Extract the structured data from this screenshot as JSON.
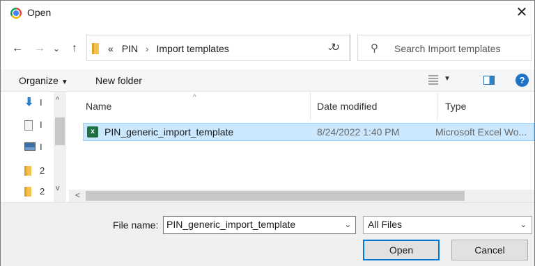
{
  "window": {
    "title": "Open",
    "close_glyph": "✕"
  },
  "nav": {
    "back_glyph": "←",
    "forward_glyph": "→",
    "recent_glyph": "⌄",
    "up_glyph": "↑",
    "breadcrumb": {
      "overflow": "«",
      "parts": [
        "PIN",
        "Import templates"
      ],
      "separator": "›"
    },
    "dropdown_glyph": "⌄",
    "refresh_glyph": "↻",
    "search_placeholder": "Search Import templates",
    "search_glyph": "⚲"
  },
  "toolbar": {
    "organize_label": "Organize",
    "organize_caret": "▼",
    "new_folder_label": "New folder",
    "view_caret": "▼",
    "help_glyph": "?"
  },
  "navpane": {
    "items": [
      {
        "icon": "download-arrow-icon",
        "glyph": "⬇",
        "text": "I"
      },
      {
        "icon": "document-icon",
        "text": "I"
      },
      {
        "icon": "pictures-icon",
        "text": "I"
      },
      {
        "icon": "folder-icon",
        "text": "2"
      },
      {
        "icon": "folder-icon",
        "text": "2"
      }
    ],
    "scroll_up": "^",
    "scroll_down": "v"
  },
  "filelist": {
    "columns": [
      "Name",
      "Date modified",
      "Type"
    ],
    "sort_glyph": "^",
    "rows": [
      {
        "icon": "excel-file-icon",
        "icon_text": "x",
        "name": "PIN_generic_import_template",
        "date": "8/24/2022 1:40 PM",
        "type": "Microsoft Excel Wo..."
      }
    ],
    "hscroll_left": "<"
  },
  "footer": {
    "file_name_label": "File name:",
    "file_name_value": "PIN_generic_import_template",
    "file_type_value": "All Files",
    "drop_glyph": "⌄",
    "open_label": "Open",
    "cancel_label": "Cancel"
  },
  "colors": {
    "selection": "#cce8ff",
    "accent": "#0078d7",
    "excel": "#1e7145"
  }
}
